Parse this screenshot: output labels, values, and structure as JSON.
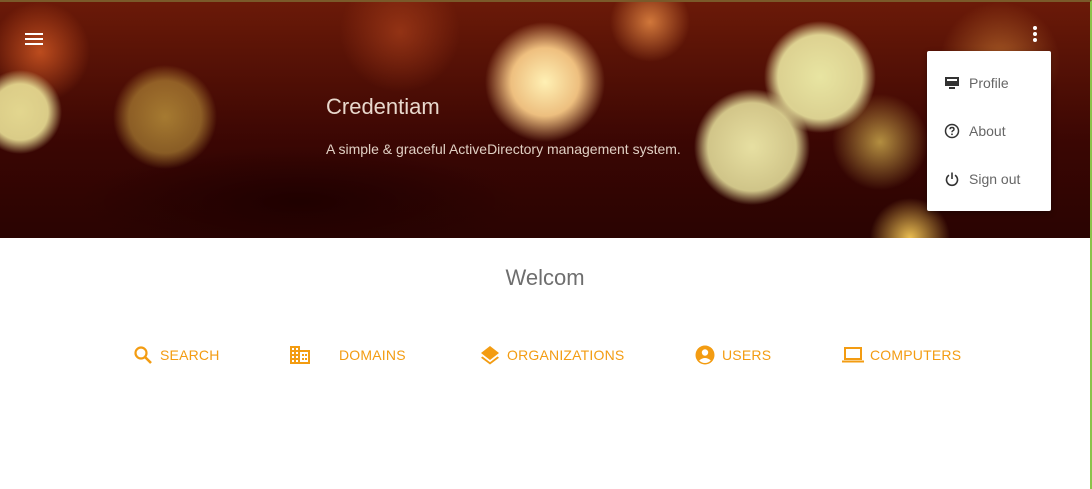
{
  "header": {
    "title": "Credentiam",
    "subtitle": "A simple & graceful ActiveDirectory management system."
  },
  "menu": {
    "items": [
      {
        "label": "Profile",
        "icon": "monitor-icon"
      },
      {
        "label": "About",
        "icon": "help-circle-icon"
      },
      {
        "label": "Sign out",
        "icon": "power-icon"
      }
    ]
  },
  "main": {
    "welcome": "Welcom",
    "nav": [
      {
        "label": "SEARCH",
        "icon": "search-icon"
      },
      {
        "label": "DOMAINS",
        "icon": "domain-icon"
      },
      {
        "label": "ORGANIZATIONS",
        "icon": "layers-icon"
      },
      {
        "label": "USERS",
        "icon": "account-circle-icon"
      },
      {
        "label": "COMPUTERS",
        "icon": "laptop-icon"
      }
    ]
  },
  "colors": {
    "accent": "#f39c12",
    "hero_dark": "#3a0603"
  }
}
